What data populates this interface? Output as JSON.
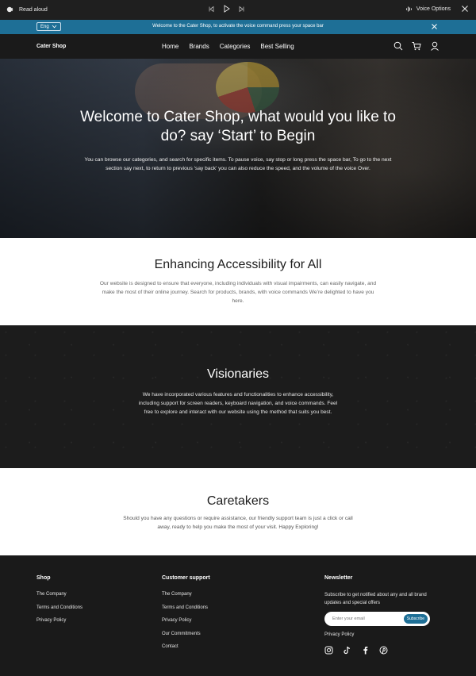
{
  "read_bar": {
    "read_aloud_label": "Read aloud",
    "voice_options_label": "Voice Options"
  },
  "announcement": {
    "language": "Eng",
    "message": "Welcome to the Cater Shop, to activate the voice command press your space bar"
  },
  "nav": {
    "brand": "Cater Shop",
    "links": [
      "Home",
      "Brands",
      "Categories",
      "Best Selling"
    ],
    "icons": [
      "search-icon",
      "cart-icon",
      "user-icon"
    ]
  },
  "hero": {
    "title": "Welcome to Cater Shop, what would you like to do? say ‘Start’ to Begin",
    "body": "You can browse our categories, and search for specific items. To pause voice, say stop or long press the space bar, To go to the next section say next, to return to previous  ‘say back’ you can also reduce the speed,  and the volume of the voice Over."
  },
  "accessibility": {
    "title": "Enhancing Accessibility for All",
    "body": "Our website is designed to ensure that everyone, including individuals with visual impairments, can easily navigate, and make the most of their online journey. Search for products,  brands, with voice  commands We’re delighted to have you here."
  },
  "visionaries": {
    "title": "Visionaries",
    "body": "We have incorporated various features and functionalities to enhance accessibility, including support for screen readers, keyboard navigation, and voice commands. Feel free to explore and interact with our website using the method that suits you best."
  },
  "caretakers": {
    "title": "Caretakers",
    "body": "Should you have any questions or require assistance, our friendly support team is just a click or call away, ready to help you make the most of your visit. Happy Exploring!"
  },
  "footer": {
    "shop": {
      "heading": "Shop",
      "links": [
        "The Company",
        "Terms and Conditions",
        "Privacy Policy"
      ]
    },
    "support": {
      "heading": "Customer support",
      "links": [
        "The Company",
        "Terms and Conditions",
        "Privacy Policy",
        "Our Commitments",
        "Contact"
      ]
    },
    "newsletter": {
      "heading": "Newsletter",
      "description": "Subscribe to get notified about any and all brand updates and special offers",
      "email_placeholder": "Enter your email",
      "subscribe_label": "Subscribe",
      "privacy_link": "Privacy Policy",
      "social_icons": [
        "instagram-icon",
        "tiktok-icon",
        "facebook-icon",
        "pinterest-icon"
      ]
    }
  },
  "colors": {
    "accent_blue": "#1e6f96",
    "dark_bg": "#1a1a1a"
  }
}
